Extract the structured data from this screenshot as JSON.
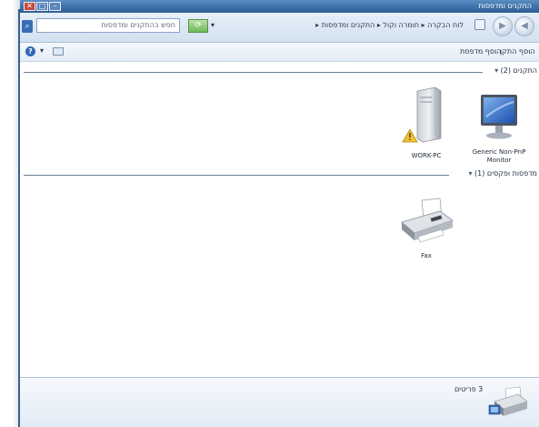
{
  "window": {
    "title": "התקנים ומדפסות",
    "controls": {
      "close": "✕",
      "maximize": "□",
      "minimize": "–"
    }
  },
  "addressbar": {
    "search_placeholder": "חפש בהתקנים ומדפסות",
    "refresh_label": "⟳",
    "dropdown_glyph": "▾",
    "breadcrumb": "לוח הבקרה ▸ חומרה וקול ▸ התקנים ומדפסות ▸"
  },
  "navigation": {
    "back": "◀",
    "forward": "▶"
  },
  "toolbar": {
    "items": [
      "הוסף התקן",
      "הוסף מדפסת"
    ],
    "help_glyph": "?",
    "help_dropdown": "▾"
  },
  "groups": [
    {
      "label": "התקנים (2)",
      "devices": [
        {
          "name": "Generic Non-PnP Monitor",
          "icon": "monitor-icon"
        },
        {
          "name": "WORK-PC",
          "icon": "computer-tower-icon",
          "warning": true
        }
      ]
    },
    {
      "label": "מדפסות ופקסים (1)",
      "devices": [
        {
          "name": "Fax",
          "icon": "fax-printer-icon"
        }
      ]
    }
  ],
  "status": {
    "text": "3 פריטים",
    "icon": "devices-printers-icon"
  },
  "colors": {
    "titlebar": "#3d6fa8",
    "group_line": "#6c7f97",
    "warning": "#f2c12e"
  }
}
